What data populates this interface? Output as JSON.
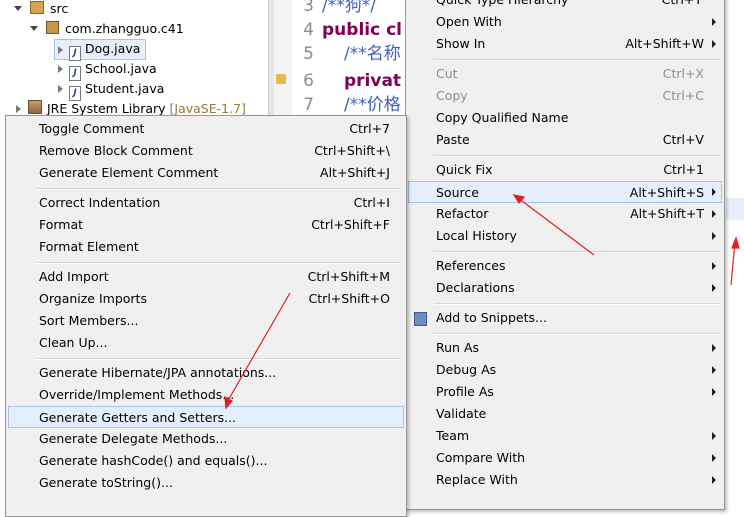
{
  "explorer": {
    "items": [
      {
        "label": "src"
      },
      {
        "label": "com.zhangguo.c41"
      },
      {
        "label": "Dog.java"
      },
      {
        "label": "School.java"
      },
      {
        "label": "Student.java"
      },
      {
        "label": "JRE System Library",
        "extra": "[JavaSE-1.7]"
      }
    ]
  },
  "editor": {
    "lines": [
      {
        "num": "3",
        "text": "/**狗*/"
      },
      {
        "num": "4",
        "text": "public cl"
      },
      {
        "num": "5",
        "text": "/**名称"
      },
      {
        "num": "6",
        "text": "privat"
      },
      {
        "num": "7",
        "text": "/**价格"
      }
    ]
  },
  "source_menu": {
    "items": [
      {
        "label": "Toggle Comment",
        "shortcut": "Ctrl+7"
      },
      {
        "label": "Remove Block Comment",
        "shortcut": "Ctrl+Shift+\\"
      },
      {
        "label": "Generate Element Comment",
        "shortcut": "Alt+Shift+J"
      },
      {
        "label": "Correct Indentation",
        "shortcut": "Ctrl+I"
      },
      {
        "label": "Format",
        "shortcut": "Ctrl+Shift+F"
      },
      {
        "label": "Format Element",
        "shortcut": ""
      },
      {
        "label": "Add Import",
        "shortcut": "Ctrl+Shift+M"
      },
      {
        "label": "Organize Imports",
        "shortcut": "Ctrl+Shift+O"
      },
      {
        "label": "Sort Members...",
        "shortcut": ""
      },
      {
        "label": "Clean Up...",
        "shortcut": ""
      },
      {
        "label": "Generate Hibernate/JPA annotations...",
        "shortcut": ""
      },
      {
        "label": "Override/Implement Methods...",
        "shortcut": ""
      },
      {
        "label": "Generate Getters and Setters...",
        "shortcut": ""
      },
      {
        "label": "Generate Delegate Methods...",
        "shortcut": ""
      },
      {
        "label": "Generate hashCode() and equals()...",
        "shortcut": ""
      },
      {
        "label": "Generate toString()...",
        "shortcut": ""
      }
    ]
  },
  "context_menu": {
    "items": [
      {
        "label": "Quick Type Hierarchy",
        "shortcut": "Ctrl+T"
      },
      {
        "label": "Open With",
        "shortcut": ""
      },
      {
        "label": "Show In",
        "shortcut": "Alt+Shift+W"
      },
      {
        "label": "Cut",
        "shortcut": "Ctrl+X"
      },
      {
        "label": "Copy",
        "shortcut": "Ctrl+C"
      },
      {
        "label": "Copy Qualified Name",
        "shortcut": ""
      },
      {
        "label": "Paste",
        "shortcut": "Ctrl+V"
      },
      {
        "label": "Quick Fix",
        "shortcut": "Ctrl+1"
      },
      {
        "label": "Source",
        "shortcut": "Alt+Shift+S"
      },
      {
        "label": "Refactor",
        "shortcut": "Alt+Shift+T"
      },
      {
        "label": "Local History",
        "shortcut": ""
      },
      {
        "label": "References",
        "shortcut": ""
      },
      {
        "label": "Declarations",
        "shortcut": ""
      },
      {
        "label": "Add to Snippets...",
        "shortcut": ""
      },
      {
        "label": "Run As",
        "shortcut": ""
      },
      {
        "label": "Debug As",
        "shortcut": ""
      },
      {
        "label": "Profile As",
        "shortcut": ""
      },
      {
        "label": "Validate",
        "shortcut": ""
      },
      {
        "label": "Team",
        "shortcut": ""
      },
      {
        "label": "Compare With",
        "shortcut": ""
      },
      {
        "label": "Replace With",
        "shortcut": ""
      }
    ]
  },
  "colors": {
    "annotation_arrow": "#e02020",
    "menu_background": "#f0f0f0",
    "highlight": "#e5effb"
  }
}
